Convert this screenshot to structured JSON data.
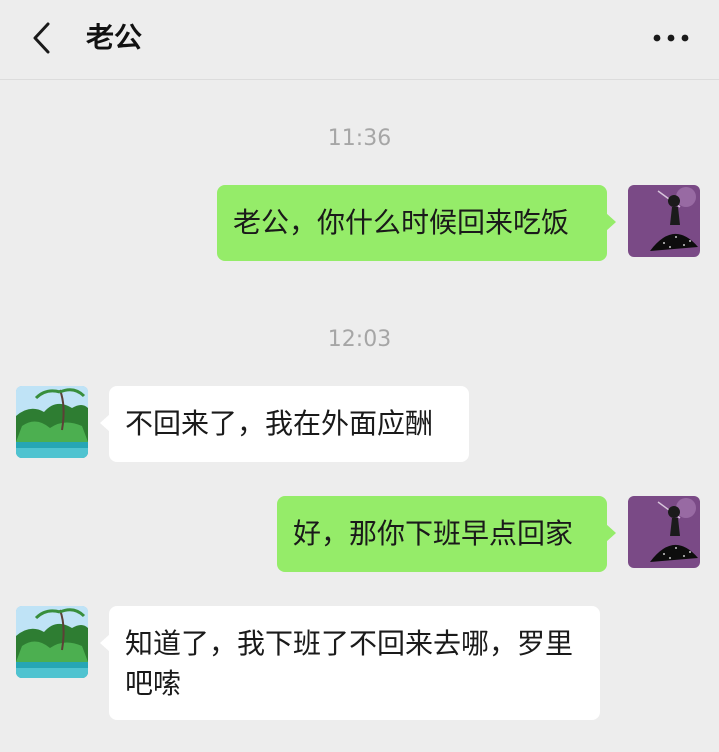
{
  "header": {
    "title": "老公",
    "back_icon": "chevron-left-icon",
    "more_icon": "more-dots-icon"
  },
  "colors": {
    "background": "#ededed",
    "my_bubble": "#95ec69",
    "their_bubble": "#ffffff",
    "timestamp": "#a6a6a6"
  },
  "messages": [
    {
      "type": "time",
      "text": "11:36"
    },
    {
      "type": "message",
      "sender": "me",
      "text": "老公，你什么时候回来吃饭"
    },
    {
      "type": "time",
      "text": "12:03"
    },
    {
      "type": "message",
      "sender": "other",
      "text": "不回来了，我在外面应酬"
    },
    {
      "type": "message",
      "sender": "me",
      "text": "好，那你下班早点回家"
    },
    {
      "type": "message",
      "sender": "other",
      "text": "知道了，我下班了不回来去哪，罗里吧嗦"
    }
  ]
}
